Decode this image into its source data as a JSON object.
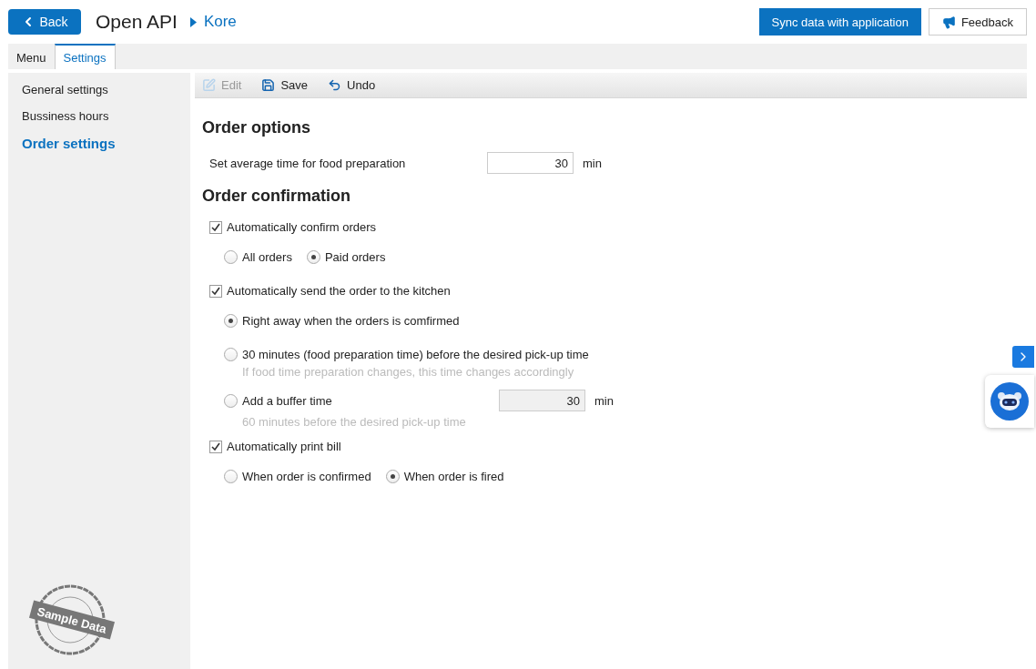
{
  "header": {
    "back_button": "Back",
    "title": "Open API",
    "breadcrumb": "Kore",
    "sync_button": "Sync data with application",
    "feedback_button": "Feedback"
  },
  "tabs": [
    {
      "label": "Menu",
      "selected": false
    },
    {
      "label": "Settings",
      "selected": true
    }
  ],
  "sidebar": {
    "items": [
      {
        "label": "General settings",
        "selected": false
      },
      {
        "label": "Bussiness hours",
        "selected": false
      },
      {
        "label": "Order settings",
        "selected": true
      }
    ]
  },
  "toolbar": [
    {
      "kind": "edit",
      "label": "Edit",
      "disabled": true
    },
    {
      "kind": "save",
      "label": "Save",
      "disabled": false
    },
    {
      "kind": "undo",
      "label": "Undo",
      "disabled": false
    }
  ],
  "sections": [
    {
      "title": "Order options",
      "items": [
        {
          "kind": "number",
          "label": "Set average time for food preparation",
          "value": "30",
          "unit": "min"
        }
      ]
    },
    {
      "title": "Order confirmation",
      "items": [
        {
          "kind": "checkbox",
          "label": "Automatically confirm orders",
          "checked": true
        },
        {
          "kind": "radio_row",
          "options": [
            {
              "label": "All orders",
              "selected": false
            },
            {
              "label": "Paid orders",
              "selected": true
            }
          ]
        },
        {
          "kind": "checkbox",
          "label": "Automatically send the order to the kitchen",
          "checked": true
        },
        {
          "kind": "radio_list",
          "options": [
            {
              "label": "Right away when the orders is comfirmed",
              "selected": true
            },
            {
              "label": "30 minutes (food preparation time) before the desired pick-up time",
              "selected": false,
              "note": "If food time preparation changes, this time changes accordingly"
            },
            {
              "label": "Add a buffer time",
              "selected": false,
              "note": "60 minutes before the desired pick-up time",
              "field": {
                "value": "30",
                "unit": "min",
                "disabled": true
              }
            }
          ]
        },
        {
          "kind": "checkbox",
          "label": "Automatically print bill",
          "checked": true
        },
        {
          "kind": "radio_row",
          "options": [
            {
              "label": "When order is confirmed",
              "selected": false
            },
            {
              "label": "When order is fired",
              "selected": true
            }
          ]
        }
      ]
    }
  ],
  "stamp": "Sample Data"
}
